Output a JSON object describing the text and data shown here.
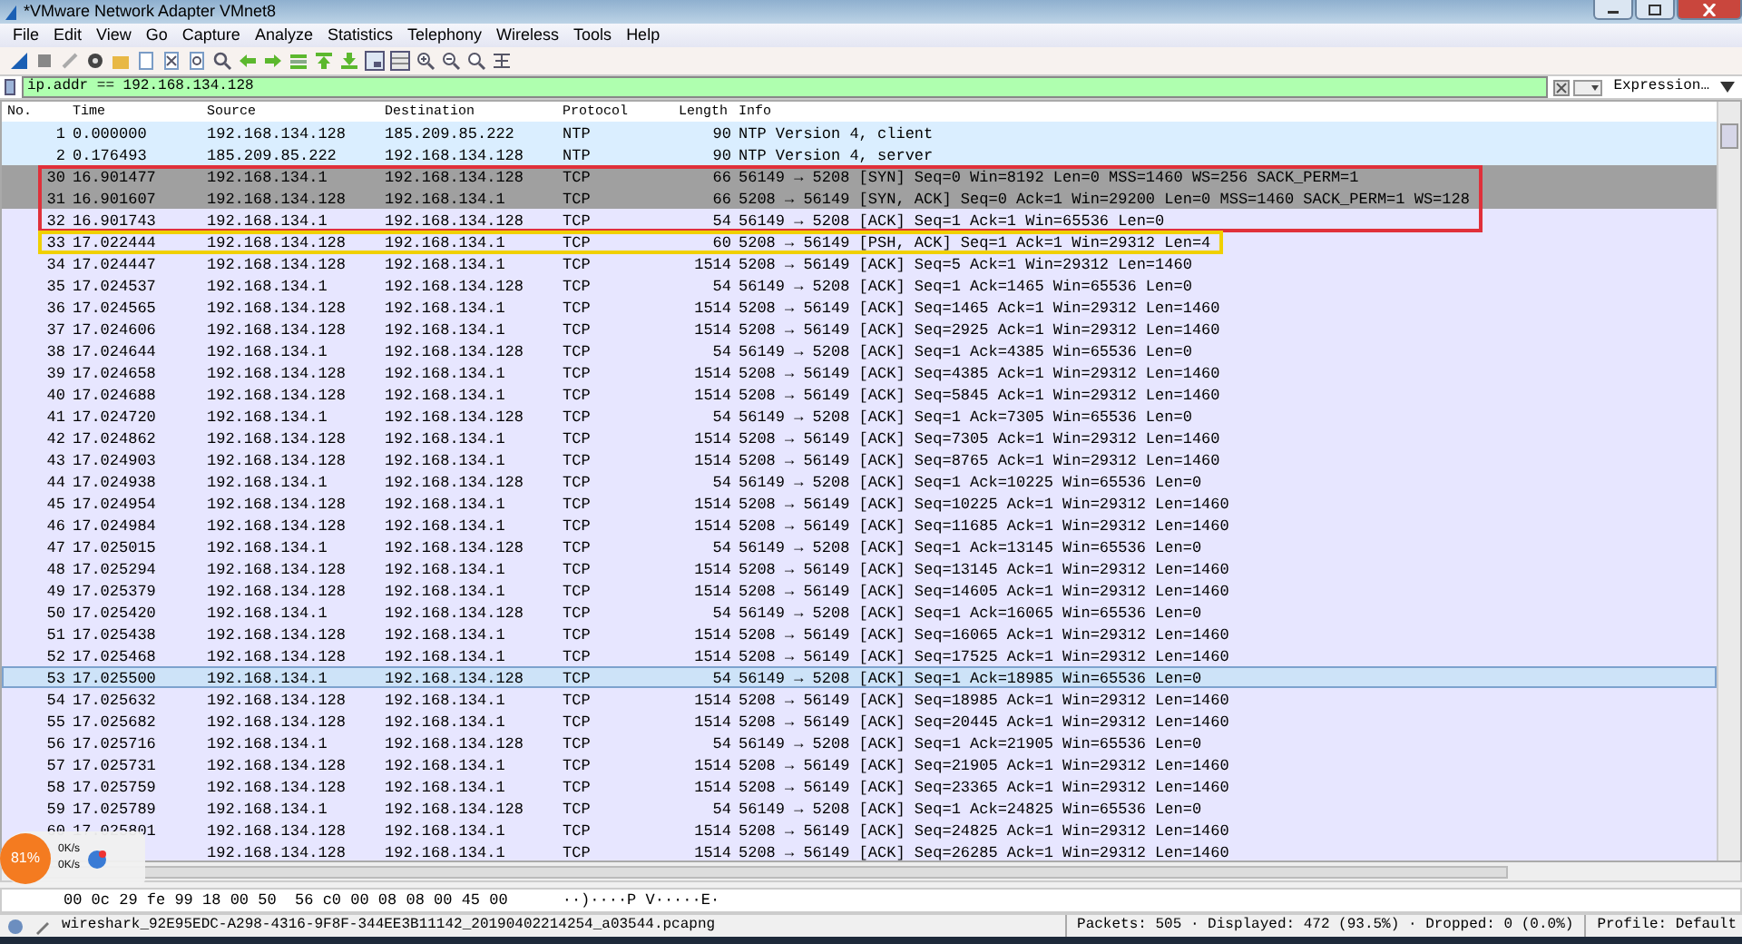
{
  "window": {
    "title": "*VMware Network Adapter VMnet8"
  },
  "menu": [
    "File",
    "Edit",
    "View",
    "Go",
    "Capture",
    "Analyze",
    "Statistics",
    "Telephony",
    "Wireless",
    "Tools",
    "Help"
  ],
  "filter": {
    "value": "ip.addr == 192.168.134.128",
    "expression_button": "Expression…"
  },
  "columns": [
    "No.",
    "Time",
    "Source",
    "Destination",
    "Protocol",
    "Length",
    "Info"
  ],
  "packets": [
    {
      "no": "1",
      "time": "0.000000",
      "source": "192.168.134.128",
      "destination": "185.209.85.222",
      "protocol": "NTP",
      "length": "90",
      "info": "NTP Version 4, client",
      "color": "#daeeff",
      "selected": false
    },
    {
      "no": "2",
      "time": "0.176493",
      "source": "185.209.85.222",
      "destination": "192.168.134.128",
      "protocol": "NTP",
      "length": "90",
      "info": "NTP Version 4, server",
      "color": "#daeeff",
      "selected": false
    },
    {
      "no": "30",
      "time": "16.901477",
      "source": "192.168.134.1",
      "destination": "192.168.134.128",
      "protocol": "TCP",
      "length": "66",
      "info": "56149 → 5208 [SYN] Seq=0 Win=8192 Len=0 MSS=1460 WS=256 SACK_PERM=1",
      "color": "#a0a0a0",
      "selected": false,
      "outline": {
        "color": "#e0303a"
      }
    },
    {
      "no": "31",
      "time": "16.901607",
      "source": "192.168.134.128",
      "destination": "192.168.134.1",
      "protocol": "TCP",
      "length": "66",
      "info": "5208 → 56149 [SYN, ACK] Seq=0 Ack=1 Win=29200 Len=0 MSS=1460 SACK_PERM=1 WS=128",
      "color": "#a0a0a0",
      "selected": false,
      "outline": {
        "color": "#e0303a"
      }
    },
    {
      "no": "32",
      "time": "16.901743",
      "source": "192.168.134.1",
      "destination": "192.168.134.128",
      "protocol": "TCP",
      "length": "54",
      "info": "56149 → 5208 [ACK] Seq=1 Ack=1 Win=65536 Len=0",
      "color": "#e7e6ff",
      "selected": false,
      "outline": {
        "color": "#e0303a"
      }
    },
    {
      "no": "33",
      "time": "17.022444",
      "source": "192.168.134.128",
      "destination": "192.168.134.1",
      "protocol": "TCP",
      "length": "60",
      "info": "5208 → 56149 [PSH, ACK] Seq=1 Ack=1 Win=29312 Len=4",
      "color": "#e7e6ff",
      "selected": false,
      "outline": {
        "color": "#f0d000"
      }
    },
    {
      "no": "34",
      "time": "17.024447",
      "source": "192.168.134.128",
      "destination": "192.168.134.1",
      "protocol": "TCP",
      "length": "1514",
      "info": "5208 → 56149 [ACK] Seq=5 Ack=1 Win=29312 Len=1460",
      "color": "#e7e6ff",
      "selected": false
    },
    {
      "no": "35",
      "time": "17.024537",
      "source": "192.168.134.1",
      "destination": "192.168.134.128",
      "protocol": "TCP",
      "length": "54",
      "info": "56149 → 5208 [ACK] Seq=1 Ack=1465 Win=65536 Len=0",
      "color": "#e7e6ff",
      "selected": false
    },
    {
      "no": "36",
      "time": "17.024565",
      "source": "192.168.134.128",
      "destination": "192.168.134.1",
      "protocol": "TCP",
      "length": "1514",
      "info": "5208 → 56149 [ACK] Seq=1465 Ack=1 Win=29312 Len=1460",
      "color": "#e7e6ff",
      "selected": false
    },
    {
      "no": "37",
      "time": "17.024606",
      "source": "192.168.134.128",
      "destination": "192.168.134.1",
      "protocol": "TCP",
      "length": "1514",
      "info": "5208 → 56149 [ACK] Seq=2925 Ack=1 Win=29312 Len=1460",
      "color": "#e7e6ff",
      "selected": false
    },
    {
      "no": "38",
      "time": "17.024644",
      "source": "192.168.134.1",
      "destination": "192.168.134.128",
      "protocol": "TCP",
      "length": "54",
      "info": "56149 → 5208 [ACK] Seq=1 Ack=4385 Win=65536 Len=0",
      "color": "#e7e6ff",
      "selected": false
    },
    {
      "no": "39",
      "time": "17.024658",
      "source": "192.168.134.128",
      "destination": "192.168.134.1",
      "protocol": "TCP",
      "length": "1514",
      "info": "5208 → 56149 [ACK] Seq=4385 Ack=1 Win=29312 Len=1460",
      "color": "#e7e6ff",
      "selected": false
    },
    {
      "no": "40",
      "time": "17.024688",
      "source": "192.168.134.128",
      "destination": "192.168.134.1",
      "protocol": "TCP",
      "length": "1514",
      "info": "5208 → 56149 [ACK] Seq=5845 Ack=1 Win=29312 Len=1460",
      "color": "#e7e6ff",
      "selected": false
    },
    {
      "no": "41",
      "time": "17.024720",
      "source": "192.168.134.1",
      "destination": "192.168.134.128",
      "protocol": "TCP",
      "length": "54",
      "info": "56149 → 5208 [ACK] Seq=1 Ack=7305 Win=65536 Len=0",
      "color": "#e7e6ff",
      "selected": false
    },
    {
      "no": "42",
      "time": "17.024862",
      "source": "192.168.134.128",
      "destination": "192.168.134.1",
      "protocol": "TCP",
      "length": "1514",
      "info": "5208 → 56149 [ACK] Seq=7305 Ack=1 Win=29312 Len=1460",
      "color": "#e7e6ff",
      "selected": false
    },
    {
      "no": "43",
      "time": "17.024903",
      "source": "192.168.134.128",
      "destination": "192.168.134.1",
      "protocol": "TCP",
      "length": "1514",
      "info": "5208 → 56149 [ACK] Seq=8765 Ack=1 Win=29312 Len=1460",
      "color": "#e7e6ff",
      "selected": false
    },
    {
      "no": "44",
      "time": "17.024938",
      "source": "192.168.134.1",
      "destination": "192.168.134.128",
      "protocol": "TCP",
      "length": "54",
      "info": "56149 → 5208 [ACK] Seq=1 Ack=10225 Win=65536 Len=0",
      "color": "#e7e6ff",
      "selected": false
    },
    {
      "no": "45",
      "time": "17.024954",
      "source": "192.168.134.128",
      "destination": "192.168.134.1",
      "protocol": "TCP",
      "length": "1514",
      "info": "5208 → 56149 [ACK] Seq=10225 Ack=1 Win=29312 Len=1460",
      "color": "#e7e6ff",
      "selected": false
    },
    {
      "no": "46",
      "time": "17.024984",
      "source": "192.168.134.128",
      "destination": "192.168.134.1",
      "protocol": "TCP",
      "length": "1514",
      "info": "5208 → 56149 [ACK] Seq=11685 Ack=1 Win=29312 Len=1460",
      "color": "#e7e6ff",
      "selected": false
    },
    {
      "no": "47",
      "time": "17.025015",
      "source": "192.168.134.1",
      "destination": "192.168.134.128",
      "protocol": "TCP",
      "length": "54",
      "info": "56149 → 5208 [ACK] Seq=1 Ack=13145 Win=65536 Len=0",
      "color": "#e7e6ff",
      "selected": false
    },
    {
      "no": "48",
      "time": "17.025294",
      "source": "192.168.134.128",
      "destination": "192.168.134.1",
      "protocol": "TCP",
      "length": "1514",
      "info": "5208 → 56149 [ACK] Seq=13145 Ack=1 Win=29312 Len=1460",
      "color": "#e7e6ff",
      "selected": false
    },
    {
      "no": "49",
      "time": "17.025379",
      "source": "192.168.134.128",
      "destination": "192.168.134.1",
      "protocol": "TCP",
      "length": "1514",
      "info": "5208 → 56149 [ACK] Seq=14605 Ack=1 Win=29312 Len=1460",
      "color": "#e7e6ff",
      "selected": false
    },
    {
      "no": "50",
      "time": "17.025420",
      "source": "192.168.134.1",
      "destination": "192.168.134.128",
      "protocol": "TCP",
      "length": "54",
      "info": "56149 → 5208 [ACK] Seq=1 Ack=16065 Win=65536 Len=0",
      "color": "#e7e6ff",
      "selected": false
    },
    {
      "no": "51",
      "time": "17.025438",
      "source": "192.168.134.128",
      "destination": "192.168.134.1",
      "protocol": "TCP",
      "length": "1514",
      "info": "5208 → 56149 [ACK] Seq=16065 Ack=1 Win=29312 Len=1460",
      "color": "#e7e6ff",
      "selected": false
    },
    {
      "no": "52",
      "time": "17.025468",
      "source": "192.168.134.128",
      "destination": "192.168.134.1",
      "protocol": "TCP",
      "length": "1514",
      "info": "5208 → 56149 [ACK] Seq=17525 Ack=1 Win=29312 Len=1460",
      "color": "#e7e6ff",
      "selected": false
    },
    {
      "no": "53",
      "time": "17.025500",
      "source": "192.168.134.1",
      "destination": "192.168.134.128",
      "protocol": "TCP",
      "length": "54",
      "info": "56149 → 5208 [ACK] Seq=1 Ack=18985 Win=65536 Len=0",
      "color": "#cde3f8",
      "selected": true
    },
    {
      "no": "54",
      "time": "17.025632",
      "source": "192.168.134.128",
      "destination": "192.168.134.1",
      "protocol": "TCP",
      "length": "1514",
      "info": "5208 → 56149 [ACK] Seq=18985 Ack=1 Win=29312 Len=1460",
      "color": "#e7e6ff",
      "selected": false
    },
    {
      "no": "55",
      "time": "17.025682",
      "source": "192.168.134.128",
      "destination": "192.168.134.1",
      "protocol": "TCP",
      "length": "1514",
      "info": "5208 → 56149 [ACK] Seq=20445 Ack=1 Win=29312 Len=1460",
      "color": "#e7e6ff",
      "selected": false
    },
    {
      "no": "56",
      "time": "17.025716",
      "source": "192.168.134.1",
      "destination": "192.168.134.128",
      "protocol": "TCP",
      "length": "54",
      "info": "56149 → 5208 [ACK] Seq=1 Ack=21905 Win=65536 Len=0",
      "color": "#e7e6ff",
      "selected": false
    },
    {
      "no": "57",
      "time": "17.025731",
      "source": "192.168.134.128",
      "destination": "192.168.134.1",
      "protocol": "TCP",
      "length": "1514",
      "info": "5208 → 56149 [ACK] Seq=21905 Ack=1 Win=29312 Len=1460",
      "color": "#e7e6ff",
      "selected": false
    },
    {
      "no": "58",
      "time": "17.025759",
      "source": "192.168.134.128",
      "destination": "192.168.134.1",
      "protocol": "TCP",
      "length": "1514",
      "info": "5208 → 56149 [ACK] Seq=23365 Ack=1 Win=29312 Len=1460",
      "color": "#e7e6ff",
      "selected": false
    },
    {
      "no": "59",
      "time": "17.025789",
      "source": "192.168.134.1",
      "destination": "192.168.134.128",
      "protocol": "TCP",
      "length": "54",
      "info": "56149 → 5208 [ACK] Seq=1 Ack=24825 Win=65536 Len=0",
      "color": "#e7e6ff",
      "selected": false
    },
    {
      "no": "60",
      "time": "17.025801",
      "source": "192.168.134.128",
      "destination": "192.168.134.1",
      "protocol": "TCP",
      "length": "1514",
      "info": "5208 → 56149 [ACK] Seq=24825 Ack=1 Win=29312 Len=1460",
      "color": "#e7e6ff",
      "selected": false
    },
    {
      "source": "192.168.134.128",
      "destination": "192.168.134.1",
      "protocol": "TCP",
      "length": "1514",
      "info": "5208 → 56149 [ACK] Seq=26285 Ack=1 Win=29312 Len=1460",
      "color": "#e7e6ff",
      "selected": false
    }
  ],
  "bytes": {
    "hex": "00 0c 29 fe 99 18 00 50  56 c0 00 08 08 00 45 00",
    "ascii": "··)····P V·····E·"
  },
  "speed_widget": {
    "percent": "81%",
    "upload": "0K/s",
    "download": "0K/s"
  },
  "status_bar": {
    "file": "wireshark_92E95EDC-A298-4316-9F8F-344EE3B11142_20190402214254_a03544.pcapng",
    "counts": "Packets: 505 · Displayed: 472 (93.5%) · Dropped: 0 (0.0%)",
    "profile": "Profile: Default"
  }
}
